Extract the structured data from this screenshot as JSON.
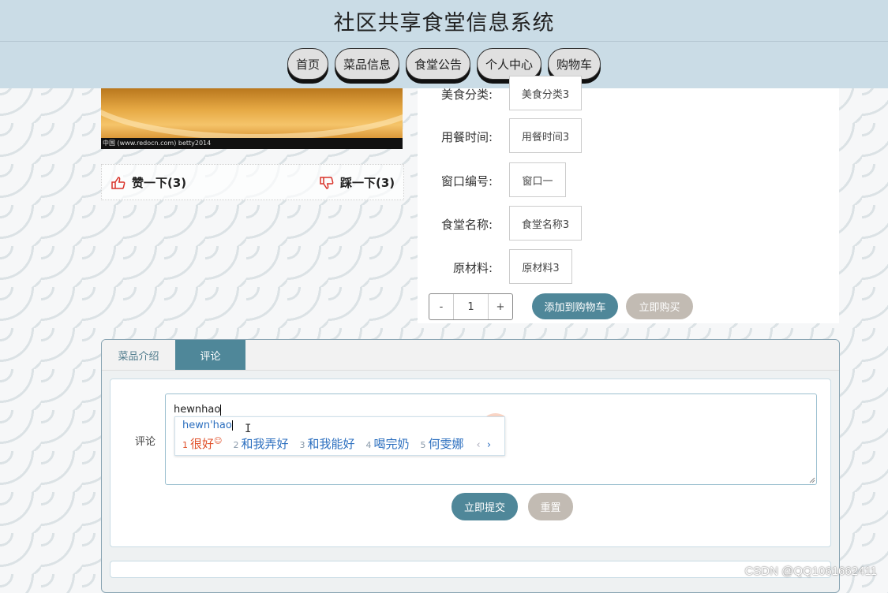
{
  "header": {
    "title": "社区共享食堂信息系统"
  },
  "nav": {
    "items": [
      "首页",
      "菜品信息",
      "食堂公告",
      "个人中心",
      "购物车"
    ]
  },
  "photo": {
    "watermark": "中国 (www.redocn.com)    betty2014"
  },
  "votes": {
    "like": "赞一下(3)",
    "dislike": "踩一下(3)"
  },
  "details": {
    "rows": [
      {
        "label": "美食分类:",
        "value": "美食分类3"
      },
      {
        "label": "用餐时间:",
        "value": "用餐时间3"
      },
      {
        "label": "窗口编号:",
        "value": "窗口一"
      },
      {
        "label": "食堂名称:",
        "value": "食堂名称3"
      },
      {
        "label": "原材料:",
        "value": "原材料3"
      }
    ],
    "quantity": {
      "minus": "-",
      "value": "1",
      "plus": "+"
    },
    "add_to_cart": "添加到购物车",
    "buy_now": "立即购买"
  },
  "tabs": {
    "intro": "菜品介绍",
    "comments": "评论"
  },
  "comment": {
    "label": "评论",
    "typed": "hewnhao",
    "ime": {
      "composition": "hewn'hao",
      "candidates": [
        {
          "num": "1",
          "text": "很好"
        },
        {
          "num": "2",
          "text": "和我弄好"
        },
        {
          "num": "3",
          "text": "和我能好"
        },
        {
          "num": "4",
          "text": "喝完奶"
        },
        {
          "num": "5",
          "text": "何雯娜"
        }
      ],
      "prev": "‹",
      "next": "›"
    },
    "submit": "立即提交",
    "reset": "重置"
  },
  "watermark": "CSDN @QQ1061662411",
  "colors": {
    "primary": "#4f8799",
    "secondary": "#c2bbb3",
    "header_bg": "#cadce6",
    "ime_highlight": "#e0502a",
    "ime_text": "#2c6fbf"
  }
}
